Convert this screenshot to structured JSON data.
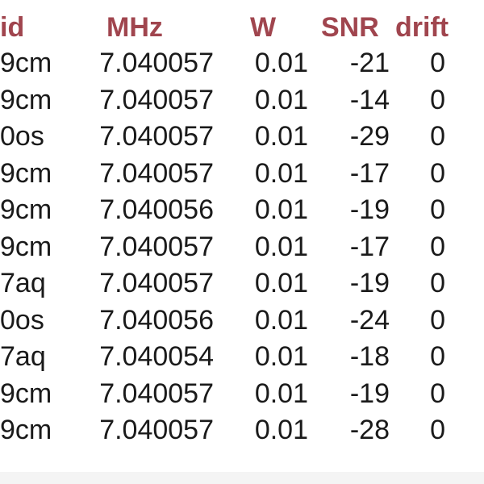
{
  "table": {
    "headers": [
      "id",
      "MHz",
      "W",
      "SNR",
      "drift"
    ],
    "rows": [
      [
        "9cm",
        "7.040057",
        "0.01",
        "-21",
        "0"
      ],
      [
        "9cm",
        "7.040057",
        "0.01",
        "-14",
        "0"
      ],
      [
        "0os",
        "7.040057",
        "0.01",
        "-29",
        "0"
      ],
      [
        "9cm",
        "7.040057",
        "0.01",
        "-17",
        "0"
      ],
      [
        "9cm",
        "7.040056",
        "0.01",
        "-19",
        "0"
      ],
      [
        "9cm",
        "7.040057",
        "0.01",
        "-17",
        "0"
      ],
      [
        "7aq",
        "7.040057",
        "0.01",
        "-19",
        "0"
      ],
      [
        "0os",
        "7.040056",
        "0.01",
        "-24",
        "0"
      ],
      [
        "7aq",
        "7.040054",
        "0.01",
        "-18",
        "0"
      ],
      [
        "9cm",
        "7.040057",
        "0.01",
        "-19",
        "0"
      ],
      [
        "9cm",
        "7.040057",
        "0.01",
        "-28",
        "0"
      ]
    ]
  },
  "colors": {
    "header_text": "#a0454e",
    "body_text": "#1a1a1a",
    "background": "#ffffff"
  }
}
